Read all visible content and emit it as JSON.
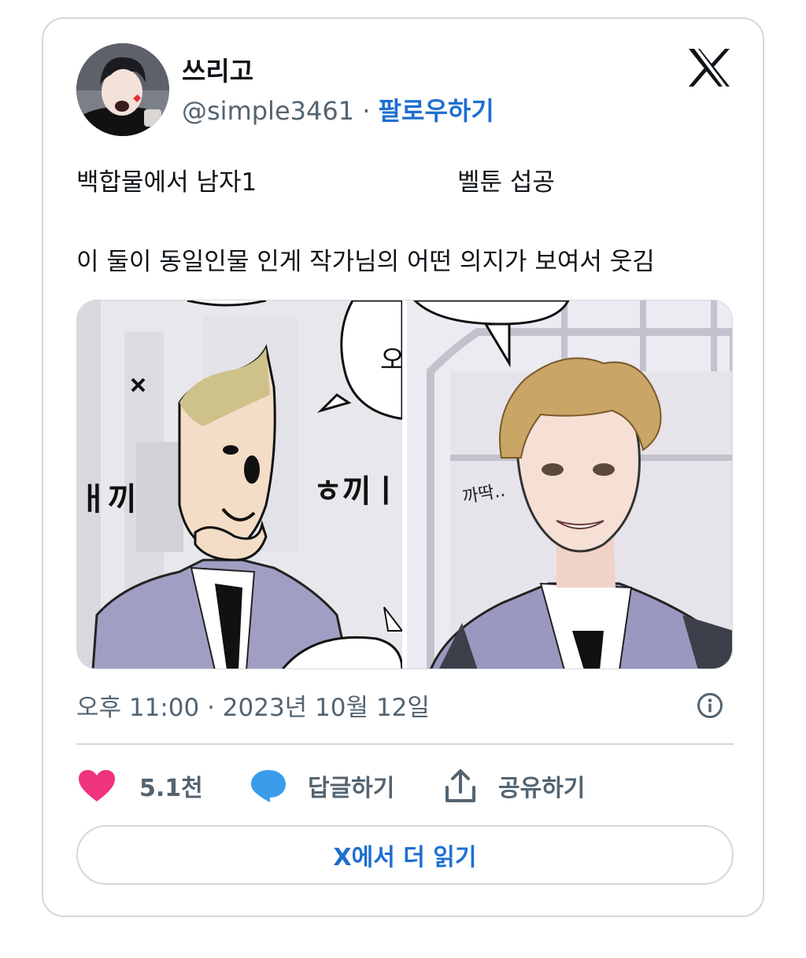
{
  "author": {
    "display_name": "쓰리고",
    "handle": "@simple3461",
    "separator": " · ",
    "follow_label": "팔로우하기"
  },
  "tweet": {
    "line1_left": "백합물에서 남자1",
    "line1_right": "벨툰 섭공",
    "line2": "이 둘이 동일인물 인게 작가님의 어떤 의지가 보여서 웃김"
  },
  "media": {
    "left_panel_sfx": [
      "ㅐ끼",
      "ㅎ끼ㅣ"
    ],
    "left_bubble_text": "오",
    "right_panel_sfx": "까딱.."
  },
  "timestamp": "오후 11:00 · 2023년 10월 12일",
  "actions": {
    "like_count": "5.1천",
    "reply_label": "답글하기",
    "share_label": "공유하기"
  },
  "read_more_label": "X에서 더 읽기",
  "colors": {
    "accent": "#1d6fd1",
    "like": "#f91880",
    "reply": "#1d9bf0",
    "muted": "#536471",
    "border": "#cfd9de"
  },
  "icons": [
    "x-logo-icon",
    "info-icon",
    "heart-icon",
    "reply-bubble-icon",
    "share-icon"
  ]
}
